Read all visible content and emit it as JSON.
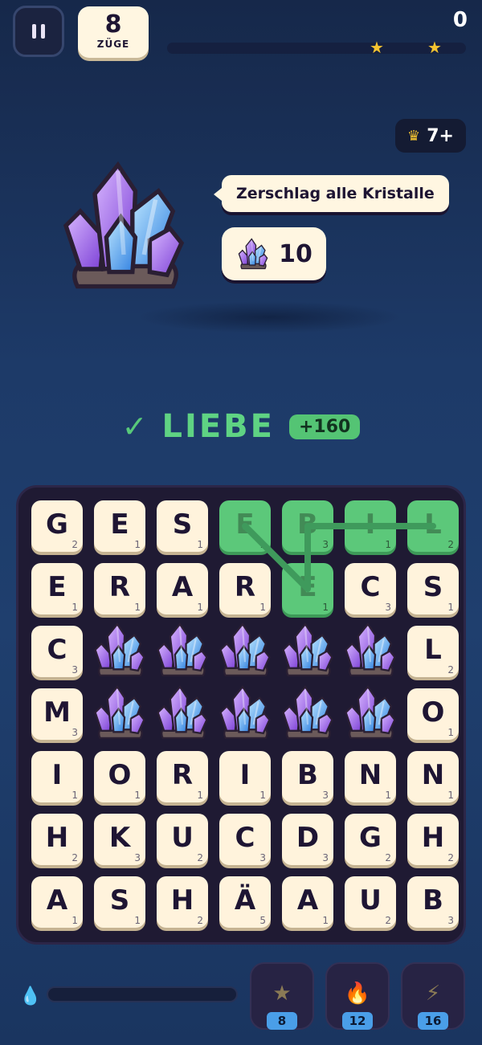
{
  "top": {
    "moves_count": "8",
    "moves_label": "ZÜGE",
    "score": "0",
    "progress": 0,
    "stars": 2
  },
  "level": {
    "icon": "crown-icon",
    "label": "7+"
  },
  "goal": {
    "icon": "crystal-icon",
    "text": "Zerschlag alle Kristalle",
    "count": "10"
  },
  "found": {
    "word": "LIEBE",
    "points": "+160"
  },
  "board": {
    "rows": [
      [
        {
          "l": "G",
          "v": "2"
        },
        {
          "l": "E",
          "v": "1"
        },
        {
          "l": "S",
          "v": "1"
        },
        {
          "l": "E",
          "v": "1",
          "sel": true
        },
        {
          "l": "B",
          "v": "3",
          "sel": true
        },
        {
          "l": "I",
          "v": "1",
          "sel": true
        },
        {
          "l": "L",
          "v": "2",
          "sel": true
        }
      ],
      [
        {
          "l": "E",
          "v": "1"
        },
        {
          "l": "R",
          "v": "1"
        },
        {
          "l": "A",
          "v": "1"
        },
        {
          "l": "R",
          "v": "1"
        },
        {
          "l": "E",
          "v": "1",
          "sel": true
        },
        {
          "l": "C",
          "v": "3"
        },
        {
          "l": "S",
          "v": "1"
        }
      ],
      [
        {
          "l": "C",
          "v": "3"
        },
        {
          "crystal": true
        },
        {
          "crystal": true
        },
        {
          "crystal": true
        },
        {
          "crystal": true
        },
        {
          "crystal": true
        },
        {
          "l": "L",
          "v": "2"
        }
      ],
      [
        {
          "l": "M",
          "v": "3"
        },
        {
          "crystal": true
        },
        {
          "crystal": true
        },
        {
          "crystal": true
        },
        {
          "crystal": true
        },
        {
          "crystal": true
        },
        {
          "l": "O",
          "v": "1"
        }
      ],
      [
        {
          "l": "I",
          "v": "1"
        },
        {
          "l": "O",
          "v": "1"
        },
        {
          "l": "R",
          "v": "1"
        },
        {
          "l": "I",
          "v": "1"
        },
        {
          "l": "B",
          "v": "3"
        },
        {
          "l": "N",
          "v": "1"
        },
        {
          "l": "N",
          "v": "1"
        }
      ],
      [
        {
          "l": "H",
          "v": "2"
        },
        {
          "l": "K",
          "v": "3"
        },
        {
          "l": "U",
          "v": "2"
        },
        {
          "l": "C",
          "v": "3"
        },
        {
          "l": "D",
          "v": "3"
        },
        {
          "l": "G",
          "v": "2"
        },
        {
          "l": "H",
          "v": "2"
        }
      ],
      [
        {
          "l": "A",
          "v": "1"
        },
        {
          "l": "S",
          "v": "1"
        },
        {
          "l": "H",
          "v": "2"
        },
        {
          "l": "Ä",
          "v": "5"
        },
        {
          "l": "A",
          "v": "1"
        },
        {
          "l": "U",
          "v": "2"
        },
        {
          "l": "B",
          "v": "3"
        }
      ]
    ],
    "path_cells": [
      [
        0,
        6
      ],
      [
        0,
        5
      ],
      [
        0,
        4
      ],
      [
        1,
        4
      ],
      [
        0,
        3
      ]
    ]
  },
  "bottom": {
    "energy_icon": "water-drop-icon",
    "energy_level": 0,
    "boosters": [
      {
        "icon": "star-icon",
        "count": "8"
      },
      {
        "icon": "fire-icon",
        "count": "12"
      },
      {
        "icon": "lightning-icon",
        "count": "16"
      }
    ]
  }
}
